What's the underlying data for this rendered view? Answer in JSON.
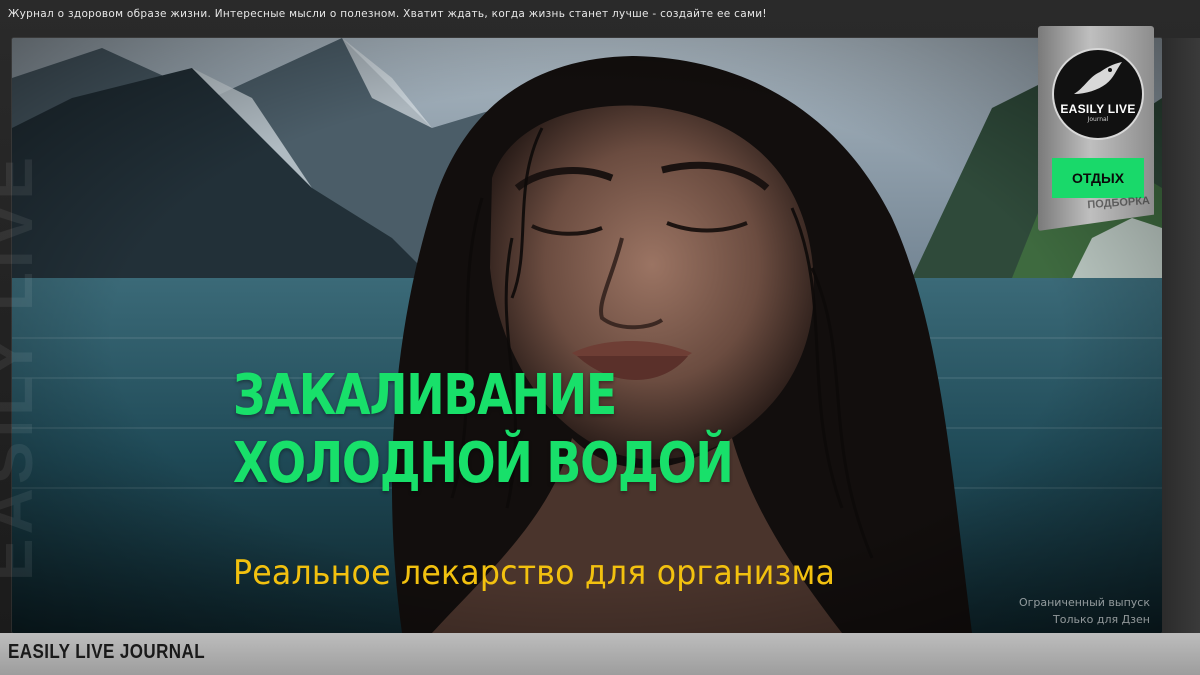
{
  "header": {
    "tagline": "Журнал о здоровом образе жизни. Интересные мысли о полезном. Хватит ждать, когда жизнь станет лучше - создайте ее сами!"
  },
  "side_watermark": "EASILY LIVE",
  "headline": {
    "line1": "ЗАКАЛИВАНИЕ",
    "line2": "ХОЛОДНОЙ ВОДОЙ",
    "subtitle": "Реальное лекарство для организма"
  },
  "badge": {
    "logo_title": "EASILY LIVE",
    "logo_subtitle": "Journal",
    "category": "ОТДЫХ",
    "type_label": "ПОДБОРКА"
  },
  "notice": {
    "line1": "Ограниченный выпуск",
    "line2": "Только для Дзен"
  },
  "footer": {
    "brand": "EASILY LIVE JOURNAL"
  },
  "colors": {
    "headline": "#18e06a",
    "subtitle": "#f2c10f",
    "category_bg": "#19d96a"
  }
}
